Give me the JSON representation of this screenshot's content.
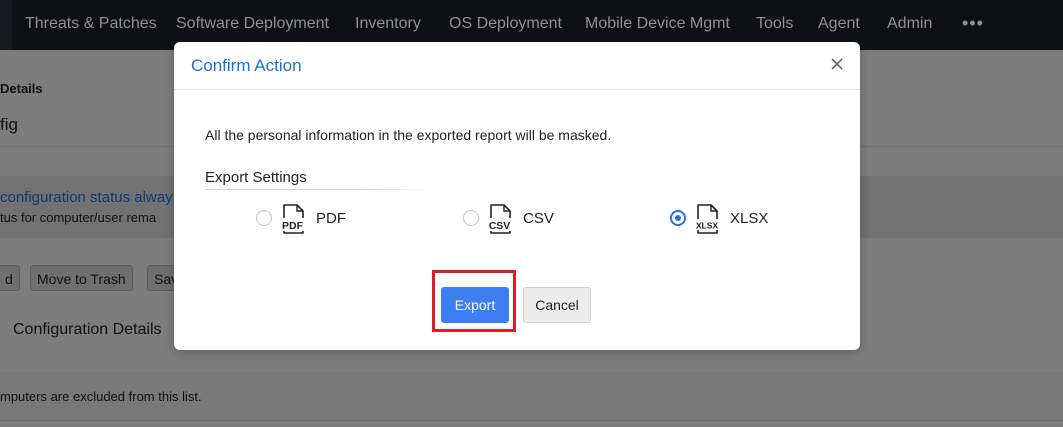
{
  "nav": {
    "items": [
      "Threats & Patches",
      "Software Deployment",
      "Inventory",
      "OS Deployment",
      "Mobile Device Mgmt",
      "Tools",
      "Agent",
      "Admin"
    ],
    "more": "•••"
  },
  "background": {
    "details_heading": "Details",
    "config_fragment": "fig",
    "notice_link": "configuration status alway",
    "notice_text": "tus for computer/user rema",
    "buttons": [
      "d",
      "Move to Trash",
      "Sav"
    ],
    "tab_label": "Configuration Details",
    "footer_note": "mputers are excluded from this list."
  },
  "modal": {
    "title": "Confirm Action",
    "message": "All the personal information in the exported report will be masked.",
    "export_settings_label": "Export Settings",
    "options": [
      {
        "label": "PDF",
        "icon": "pdf-file-icon",
        "selected": false
      },
      {
        "label": "CSV",
        "icon": "csv-file-icon",
        "selected": false
      },
      {
        "label": "XLSX",
        "icon": "xlsx-file-icon",
        "selected": true
      }
    ],
    "export_label": "Export",
    "cancel_label": "Cancel",
    "colors": {
      "title": "#1f6fd1",
      "primary": "#3d7ff0",
      "highlight": "#e01b24"
    }
  },
  "file_icon_tags": {
    "pdf": "PDF",
    "csv": "CSV",
    "xlsx": "XLSX"
  }
}
